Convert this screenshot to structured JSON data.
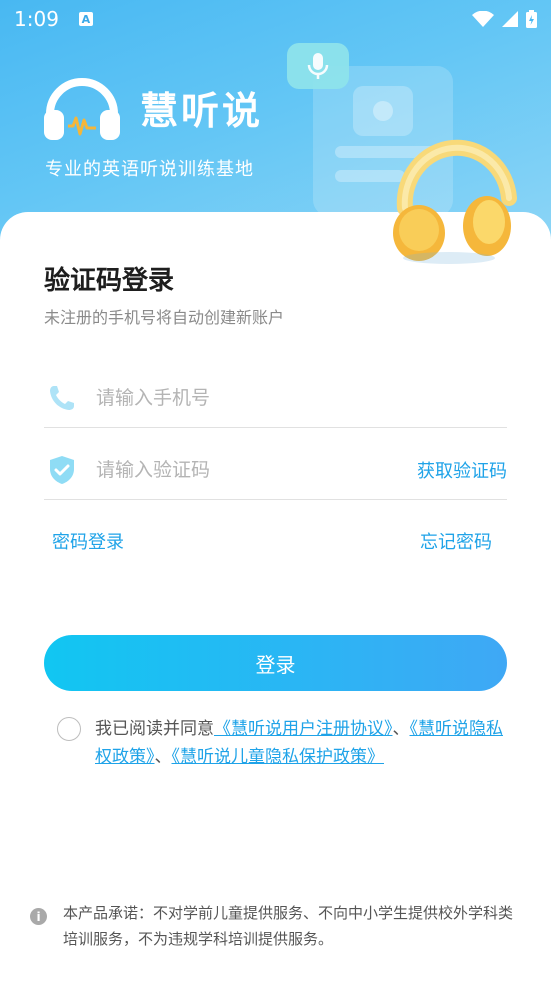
{
  "status_bar": {
    "time": "1:09",
    "indicator": "A"
  },
  "header": {
    "app_title": "慧听说",
    "tagline": "专业的英语听说训练基地"
  },
  "login": {
    "title": "验证码登录",
    "subtitle": "未注册的手机号将自动创建新账户",
    "phone_placeholder": "请输入手机号",
    "phone_value": "",
    "code_placeholder": "请输入验证码",
    "code_value": "",
    "get_code_label": "获取验证码",
    "password_login_label": "密码登录",
    "forgot_password_label": "忘记密码",
    "login_button_label": "登录"
  },
  "agreement": {
    "prefix": "我已阅读并同意",
    "links": [
      "《慧听说用户注册协议》",
      "《慧听说隐私权政策》",
      "《慧听说儿童隐私保护政策》"
    ],
    "separator": "、",
    "checked": false
  },
  "notice": {
    "text": "本产品承诺：不对学前儿童提供服务、不向中小学生提供校外学科类培训服务，不为违规学科培训提供服务。"
  },
  "colors": {
    "accent": "#1fa3e8",
    "hero_start": "#48b8f2",
    "hero_end": "#8fd6f6",
    "button_start": "#11c6f2",
    "button_end": "#3fa8f5",
    "headphone_gold": "#f9c547"
  },
  "icons": {
    "phone": "phone-icon",
    "shield": "shield-check-icon",
    "info": "info-icon",
    "logo": "headphones-logo-icon",
    "mic": "microphone-icon"
  }
}
